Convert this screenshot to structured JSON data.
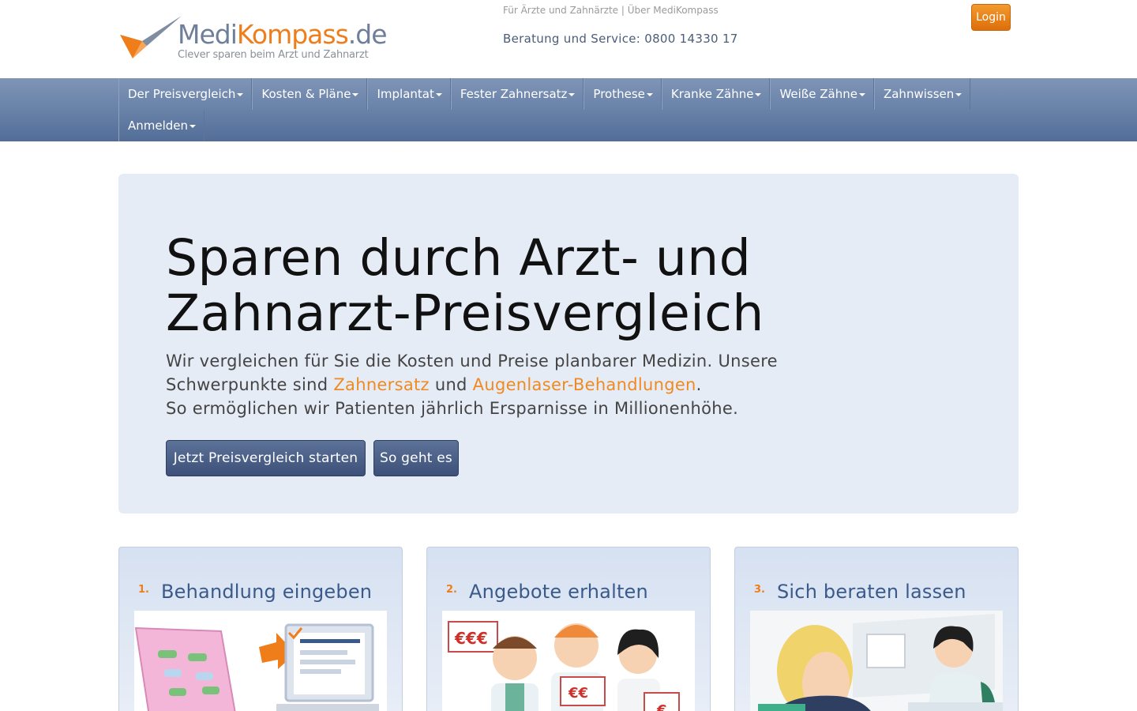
{
  "header": {
    "logo_medi": "Medi",
    "logo_kompass": "Kompass",
    "logo_de": ".de",
    "logo_tagline": "Clever sparen beim Arzt und Zahnarzt",
    "toplink_doctors": "Für Ärzte und Zahnärzte",
    "toplink_separator": " | ",
    "toplink_about": "Über MediKompass",
    "service_text": "Beratung und Service: 0800 14330 17",
    "login_label": "Login"
  },
  "nav": {
    "items": [
      {
        "label": "Der Preisvergleich"
      },
      {
        "label": "Kosten & Pläne"
      },
      {
        "label": "Implantat"
      },
      {
        "label": "Fester Zahnersatz"
      },
      {
        "label": "Prothese"
      },
      {
        "label": "Kranke Zähne"
      },
      {
        "label": "Weiße Zähne"
      },
      {
        "label": "Zahnwissen"
      },
      {
        "label": "Anmelden"
      }
    ]
  },
  "hero": {
    "title_line1": "Sparen durch Arzt- und",
    "title_line2": "Zahnarzt-Preisvergleich",
    "lead_part1": "Wir vergleichen für Sie die Kosten und Preise planbarer Medizin. Unsere Schwerpunkte sind ",
    "lead_link1": "Zahnersatz",
    "lead_part2": " und ",
    "lead_link2": "Augenlaser-Behandlungen",
    "lead_part3": ".",
    "lead_line2": "So ermöglichen wir Patienten jährlich Ersparnisse in Millionenhöhe.",
    "btn_start": "Jetzt Preisvergleich starten",
    "btn_how": "So geht es"
  },
  "steps": [
    {
      "num": "1.",
      "title": "Behandlung eingeben"
    },
    {
      "num": "2.",
      "title": "Angebote erhalten"
    },
    {
      "num": "3.",
      "title": "Sich beraten lassen"
    }
  ],
  "illustrations": {
    "step2_sign1": "€€€",
    "step2_sign2": "€€",
    "step2_sign3": "€"
  },
  "colors": {
    "brand_orange": "#ef7d1a",
    "brand_blue": "#3a5a8c",
    "nav_top": "#7f95b7",
    "nav_bottom": "#526e98",
    "hero_bg": "#e6ecf6"
  }
}
